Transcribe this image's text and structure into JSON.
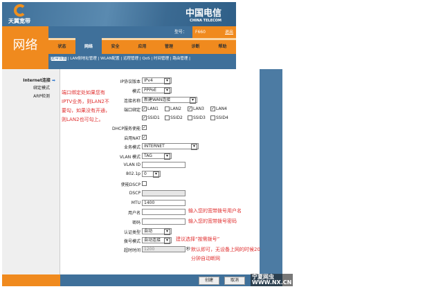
{
  "header": {
    "brand": "天翼宽带",
    "operator": "中国电信",
    "operator_en": "CHINA TELECOM"
  },
  "section_title": "网络",
  "model_label": "型号：",
  "model": "F660",
  "logout": "退出",
  "tabs": [
    "状态",
    "网络",
    "安全",
    "应用",
    "管理",
    "诊断",
    "帮助"
  ],
  "active_tab": 1,
  "submenu": [
    "宽带设置",
    "LAN侧地址管理",
    "WLAN配置",
    "远程管理",
    "QoS",
    "时间管理",
    "路由管理"
  ],
  "sidebar": [
    "Internet连接",
    "绑定模式",
    "ARP检测"
  ],
  "form": {
    "ip_version": {
      "label": "IP协议版本",
      "value": "IPv4"
    },
    "mode": {
      "label": "模式",
      "value": "PPPoE"
    },
    "conn_name": {
      "label": "连接名称",
      "value": "新建WAN连接"
    },
    "port_bind": {
      "label": "端口绑定",
      "options": [
        {
          "name": "LAN1",
          "checked": true
        },
        {
          "name": "LAN2",
          "checked": false
        },
        {
          "name": "LAN3",
          "checked": true
        },
        {
          "name": "LAN4",
          "checked": true
        },
        {
          "name": "SSID1",
          "checked": true
        },
        {
          "name": "SSID2",
          "checked": false
        },
        {
          "name": "SSID3",
          "checked": false
        },
        {
          "name": "SSID4",
          "checked": false
        }
      ]
    },
    "dhcp": {
      "label": "DHCP服务使能",
      "checked": true
    },
    "nat": {
      "label": "启用NAT",
      "checked": true
    },
    "service": {
      "label": "业务模式",
      "value": "INTERNET"
    },
    "vlan_mode": {
      "label": "VLAN 模式",
      "value": "TAG"
    },
    "vlan_id": {
      "label": "VLAN ID",
      "value": ""
    },
    "p8021": {
      "label": "802.1p",
      "value": "0"
    },
    "dscp_en": {
      "label": "使能DSCP",
      "checked": false
    },
    "dscp": {
      "label": "DSCP",
      "value": ""
    },
    "mtu": {
      "label": "MTU",
      "value": "1400"
    },
    "username": {
      "label": "用户名",
      "value": ""
    },
    "password": {
      "label": "密码",
      "value": ""
    },
    "auth": {
      "label": "认证类型",
      "value": "自动"
    },
    "dial": {
      "label": "拨号模式",
      "value": "自动连接"
    },
    "idle": {
      "label": "超时时间",
      "value": "1200",
      "unit": "秒"
    }
  },
  "notes": {
    "port": "端口绑定处如果您有IPTV业务，则LAN2不要勾，如果没有开通，则LAN2也可勾上。",
    "username": "输入您的宽带拨号用户名",
    "password": "输入您的宽带拨号密码",
    "dial": "建议选择“按需拨号”",
    "idle": "默认即可，无设备上网的时候20分钟自动断网"
  },
  "buttons": {
    "create": "创建",
    "cancel": "取消"
  },
  "watermark": {
    "line1": "宁夏网虫",
    "line2": "WWW.NX.CN"
  }
}
